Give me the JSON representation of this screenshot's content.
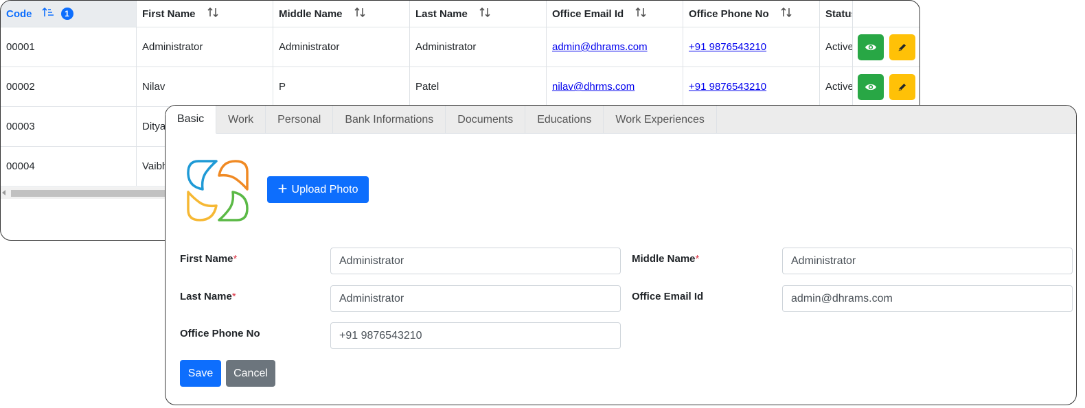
{
  "table": {
    "columns": [
      {
        "label": "Code",
        "sorted": true,
        "sort_order": "1"
      },
      {
        "label": "First Name"
      },
      {
        "label": "Middle Name"
      },
      {
        "label": "Last Name"
      },
      {
        "label": "Office Email Id"
      },
      {
        "label": "Office Phone No"
      },
      {
        "label": "Status"
      }
    ],
    "rows": [
      {
        "code": "00001",
        "first": "Administrator",
        "middle": "Administrator",
        "last": "Administrator",
        "email": "admin@dhrams.com",
        "phone": "+91 9876543210",
        "status": "Active"
      },
      {
        "code": "00002",
        "first": "Nilav",
        "middle": "P",
        "last": "Patel",
        "email": "nilav@dhrms.com",
        "phone": "+91 9876543210",
        "status": "Active"
      },
      {
        "code": "00003",
        "first": "Ditya",
        "middle": "",
        "last": "",
        "email": "",
        "phone": "",
        "status": ""
      },
      {
        "code": "00004",
        "first": "Vaibh",
        "middle": "",
        "last": "",
        "email": "",
        "phone": "",
        "status": ""
      }
    ],
    "row_actions": [
      "eye-icon",
      "pencil-icon"
    ]
  },
  "form": {
    "tabs": [
      "Basic",
      "Work",
      "Personal",
      "Bank Informations",
      "Documents",
      "Educations",
      "Work Experiences"
    ],
    "active_tab": "Basic",
    "upload_label": "Upload Photo",
    "fields": {
      "first_name": {
        "label": "First Name",
        "required": "*",
        "value": "Administrator"
      },
      "middle_name": {
        "label": "Middle Name",
        "required": "*",
        "value": "Administrator"
      },
      "last_name": {
        "label": "Last Name",
        "required": "*",
        "value": "Administrator"
      },
      "office_email": {
        "label": "Office Email Id",
        "value": "admin@dhrams.com"
      },
      "office_phone": {
        "label": "Office Phone No",
        "value": "+91 9876543210"
      }
    },
    "save_label": "Save",
    "cancel_label": "Cancel"
  },
  "colors": {
    "primary": "#0d6efd",
    "success": "#28a745",
    "warning": "#ffc107",
    "secondary": "#6c757d",
    "required": "#dc3545"
  }
}
